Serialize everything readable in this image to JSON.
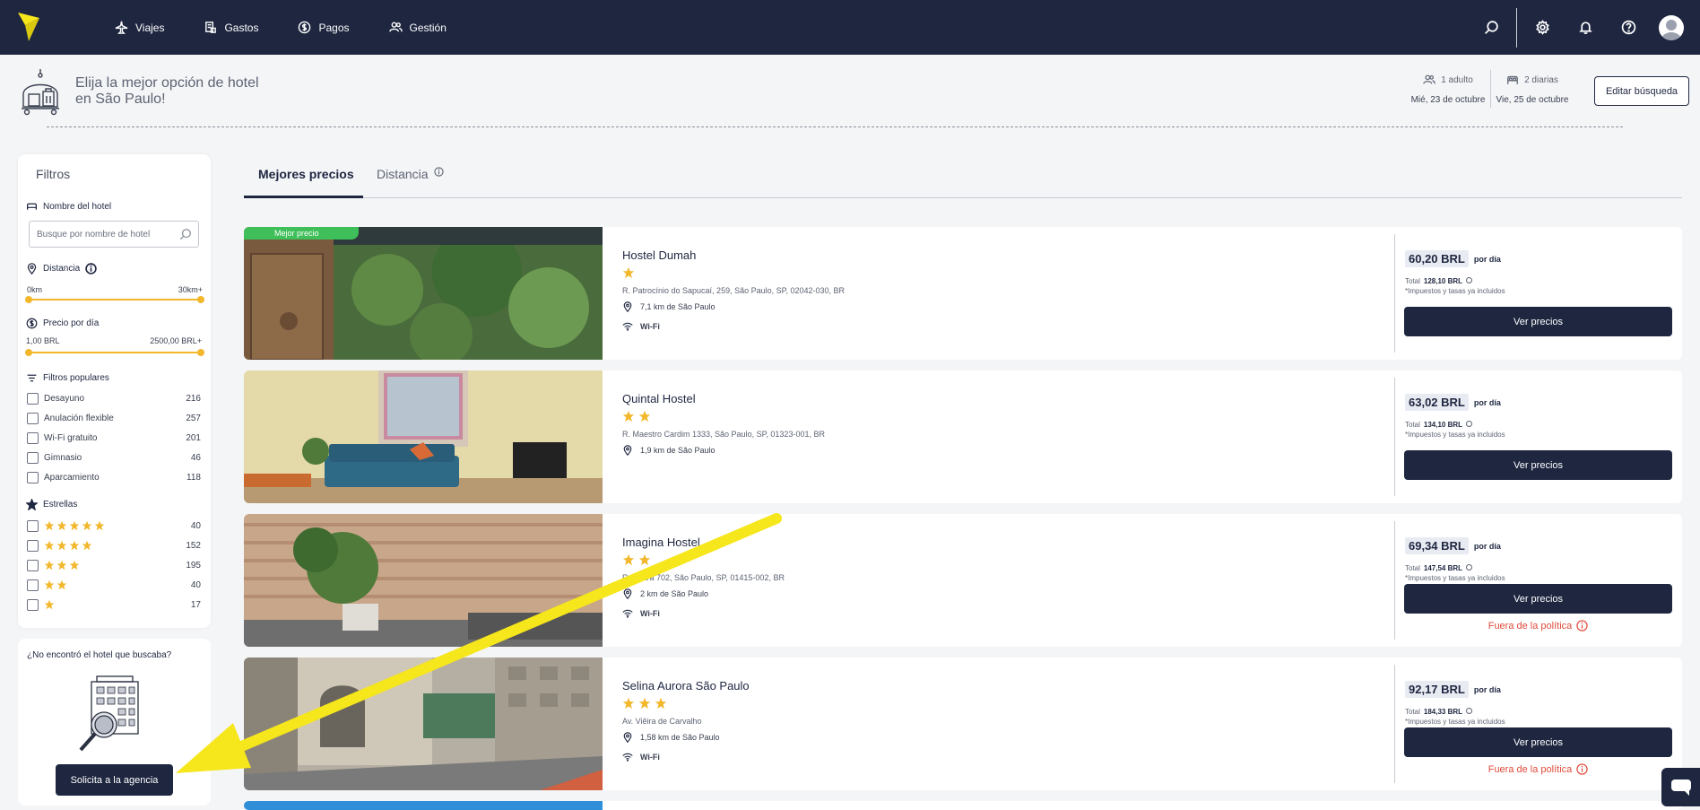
{
  "nav": {
    "items": [
      {
        "label": "Viajes",
        "icon": "airplane-icon"
      },
      {
        "label": "Gastos",
        "icon": "receipt-icon"
      },
      {
        "label": "Pagos",
        "icon": "dollar-icon"
      },
      {
        "label": "Gestión",
        "icon": "users-icon"
      }
    ],
    "right_icons": [
      "search-icon",
      "gear-icon",
      "bell-icon",
      "help-icon",
      "avatar"
    ]
  },
  "header": {
    "title_line1": "Elija la mejor opción de hotel",
    "title_line2": "en São Paulo!",
    "guests": "1 adulto",
    "checkin": "Mié, 23 de octubre",
    "nights": "2 diarias",
    "checkout": "Vie, 25 de octubre",
    "edit_label": "Editar búsqueda"
  },
  "filters": {
    "title": "Filtros",
    "hotel_name_label": "Nombre del hotel",
    "search_placeholder": "Busque por nombre de hotel",
    "distance_label": "Distancia",
    "distance_min": "0km",
    "distance_max": "30km+",
    "price_label": "Precio por día",
    "price_min": "1,00 BRL",
    "price_max": "2500,00 BRL+",
    "popular_label": "Filtros populares",
    "popular": [
      {
        "label": "Desayuno",
        "count": "216"
      },
      {
        "label": "Anulación flexible",
        "count": "257"
      },
      {
        "label": "Wi-Fi gratuito",
        "count": "201"
      },
      {
        "label": "Gimnasio",
        "count": "46"
      },
      {
        "label": "Aparcamiento",
        "count": "118"
      }
    ],
    "stars_label": "Estrellas",
    "stars": [
      {
        "stars": 5,
        "count": "40"
      },
      {
        "stars": 4,
        "count": "152"
      },
      {
        "stars": 3,
        "count": "195"
      },
      {
        "stars": 2,
        "count": "40"
      },
      {
        "stars": 1,
        "count": "17"
      }
    ]
  },
  "agency": {
    "question": "¿No encontró el hotel que buscaba?",
    "button": "Solicita a la agencia"
  },
  "tabs": [
    {
      "label": "Mejores precios",
      "active": true
    },
    {
      "label": "Distancia",
      "active": false
    }
  ],
  "hotels": [
    {
      "badge": "Mejor precio",
      "name": "Hostel Dumah",
      "stars": 1,
      "address": "R. Patrocínio do Sapucaí, 259, São Paulo, SP, 02042-030, BR",
      "distance": "7,1 km de São Paulo",
      "wifi": "Wi-Fi",
      "price": "60,20 BRL",
      "per": "por día",
      "total_label": "Total",
      "total": "128,10 BRL",
      "taxes": "*Impuestos y tasas ya incluidos",
      "button": "Ver precios",
      "policy": ""
    },
    {
      "badge": "",
      "name": "Quintal Hostel",
      "stars": 2,
      "address": "R. Maestro Cardim 1333, São Paulo, SP, 01323-001, BR",
      "distance": "1,9 km de São Paulo",
      "wifi": "",
      "price": "63,02 BRL",
      "per": "por día",
      "total_label": "Total",
      "total": "134,10 BRL",
      "taxes": "*Impuestos y tasas ya incluidos",
      "button": "Ver precios",
      "policy": ""
    },
    {
      "badge": "",
      "name": "Imagina Hostel",
      "stars": 2,
      "address": "R. Cintra 702, São Paulo, SP, 01415-002, BR",
      "distance": "2 km de São Paulo",
      "wifi": "Wi-Fi",
      "price": "69,34 BRL",
      "per": "por día",
      "total_label": "Total",
      "total": "147,54 BRL",
      "taxes": "*Impuestos y tasas ya incluidos",
      "button": "Ver precios",
      "policy": "Fuera de la política"
    },
    {
      "badge": "",
      "name": "Selina Aurora São Paulo",
      "stars": 3,
      "address": "Av. Viêira de Carvalho",
      "distance": "1,58 km de São Paulo",
      "wifi": "Wi-Fi",
      "price": "92,17 BRL",
      "per": "por día",
      "total_label": "Total",
      "total": "184,33 BRL",
      "taxes": "*Impuestos y tasas ya incluidos",
      "button": "Ver precios",
      "policy": "Fuera de la política"
    }
  ],
  "colors": {
    "navy": "#1e2640",
    "star": "#f2b72a",
    "badge": "#3fbf5a",
    "policy": "#e04a3a",
    "annotation_arrow": "#f6e61c"
  }
}
